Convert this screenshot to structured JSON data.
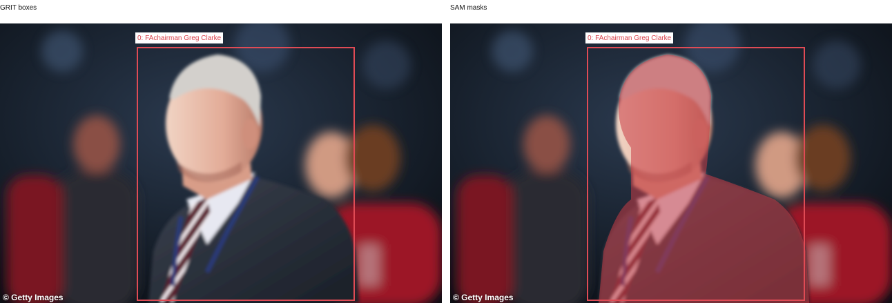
{
  "panels": [
    {
      "title": "GRIT boxes",
      "detection_label": "0: FAchairman Greg Clarke",
      "watermark": "© Getty Images",
      "mask": false
    },
    {
      "title": "SAM masks",
      "detection_label": "0: FAchairman Greg Clarke",
      "watermark": "© Getty Images",
      "mask": true
    }
  ],
  "colors": {
    "box": "#e04b55",
    "label_text": "#d9434d",
    "mask_fill": "#c83c46"
  }
}
